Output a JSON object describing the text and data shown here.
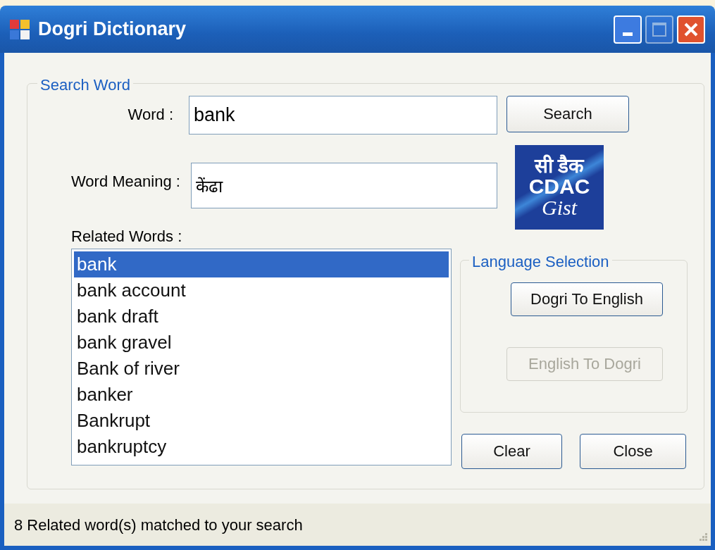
{
  "window": {
    "title": "Dogri Dictionary",
    "controls": [
      {
        "kind": "minimize",
        "disabled": false
      },
      {
        "kind": "maximize",
        "disabled": true
      },
      {
        "kind": "close",
        "disabled": false
      }
    ]
  },
  "search_group": {
    "title": "Search Word",
    "word": {
      "label": "Word :",
      "value": "bank"
    },
    "search_button": {
      "label": "Search",
      "disabled": false
    },
    "meaning": {
      "label": "Word Meaning :",
      "value": "केंढा"
    },
    "logo": {
      "lines": [
        "सी डैक",
        "CDAC",
        "Gist"
      ]
    },
    "related": {
      "label": "Related Words :",
      "items": [
        {
          "text": "bank",
          "selected": true
        },
        {
          "text": "bank account",
          "selected": false
        },
        {
          "text": "bank draft",
          "selected": false
        },
        {
          "text": "bank gravel",
          "selected": false
        },
        {
          "text": "Bank of river",
          "selected": false
        },
        {
          "text": "banker",
          "selected": false
        },
        {
          "text": "Bankrupt",
          "selected": false
        },
        {
          "text": "bankruptcy",
          "selected": false
        }
      ]
    },
    "language_selection": {
      "title": "Language Selection",
      "buttons": [
        {
          "label": "Dogri To English",
          "disabled": false
        },
        {
          "label": "English To Dogri",
          "disabled": true
        }
      ]
    },
    "buttons": [
      {
        "label": "Clear",
        "disabled": false
      },
      {
        "label": "Close",
        "disabled": false
      }
    ]
  },
  "status_bar": {
    "text": "8 Related word(s) matched to your search"
  }
}
